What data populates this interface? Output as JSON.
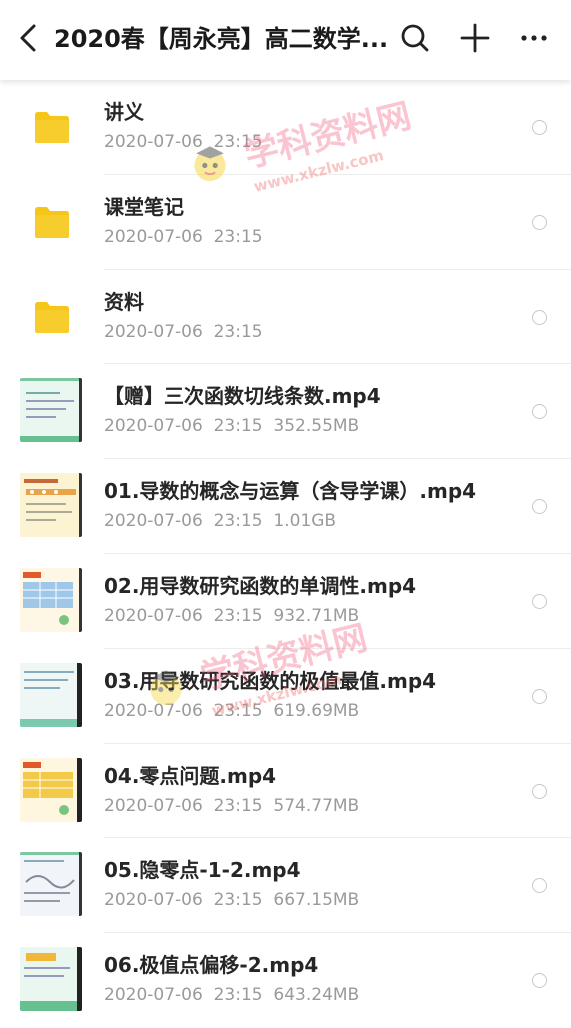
{
  "header": {
    "title": "2020春【周永亮】高二数学...",
    "back_icon": "back-chevron-icon",
    "search_icon": "search-icon",
    "add_icon": "plus-icon",
    "more_icon": "more-dots-icon"
  },
  "items": [
    {
      "type": "folder",
      "name": "讲义",
      "meta": "2020-07-06  23:15"
    },
    {
      "type": "folder",
      "name": "课堂笔记",
      "meta": "2020-07-06  23:15"
    },
    {
      "type": "folder",
      "name": "资料",
      "meta": "2020-07-06  23:15"
    },
    {
      "type": "video",
      "name": "【赠】三次函数切线条数.mp4",
      "meta": "2020-07-06  23:15  352.55MB"
    },
    {
      "type": "video",
      "name": "01.导数的概念与运算（含导学课）.mp4",
      "meta": "2020-07-06  23:15  1.01GB"
    },
    {
      "type": "video",
      "name": "02.用导数研究函数的单调性.mp4",
      "meta": "2020-07-06  23:15  932.71MB"
    },
    {
      "type": "video",
      "name": "03.用导数研究函数的极值最值.mp4",
      "meta": "2020-07-06  23:15  619.69MB"
    },
    {
      "type": "video",
      "name": "04.零点问题.mp4",
      "meta": "2020-07-06  23:15  574.77MB"
    },
    {
      "type": "video",
      "name": "05.隐零点-1-2.mp4",
      "meta": "2020-07-06  23:15  667.15MB"
    },
    {
      "type": "video",
      "name": "06.极值点偏移-2.mp4",
      "meta": "2020-07-06  23:15  643.24MB"
    }
  ],
  "watermark": {
    "text": "学科资料网",
    "url": "www.xkzlw.com"
  },
  "colors": {
    "folder": "#f5c518",
    "meta": "#9a9a9a",
    "divider": "#ececec"
  }
}
